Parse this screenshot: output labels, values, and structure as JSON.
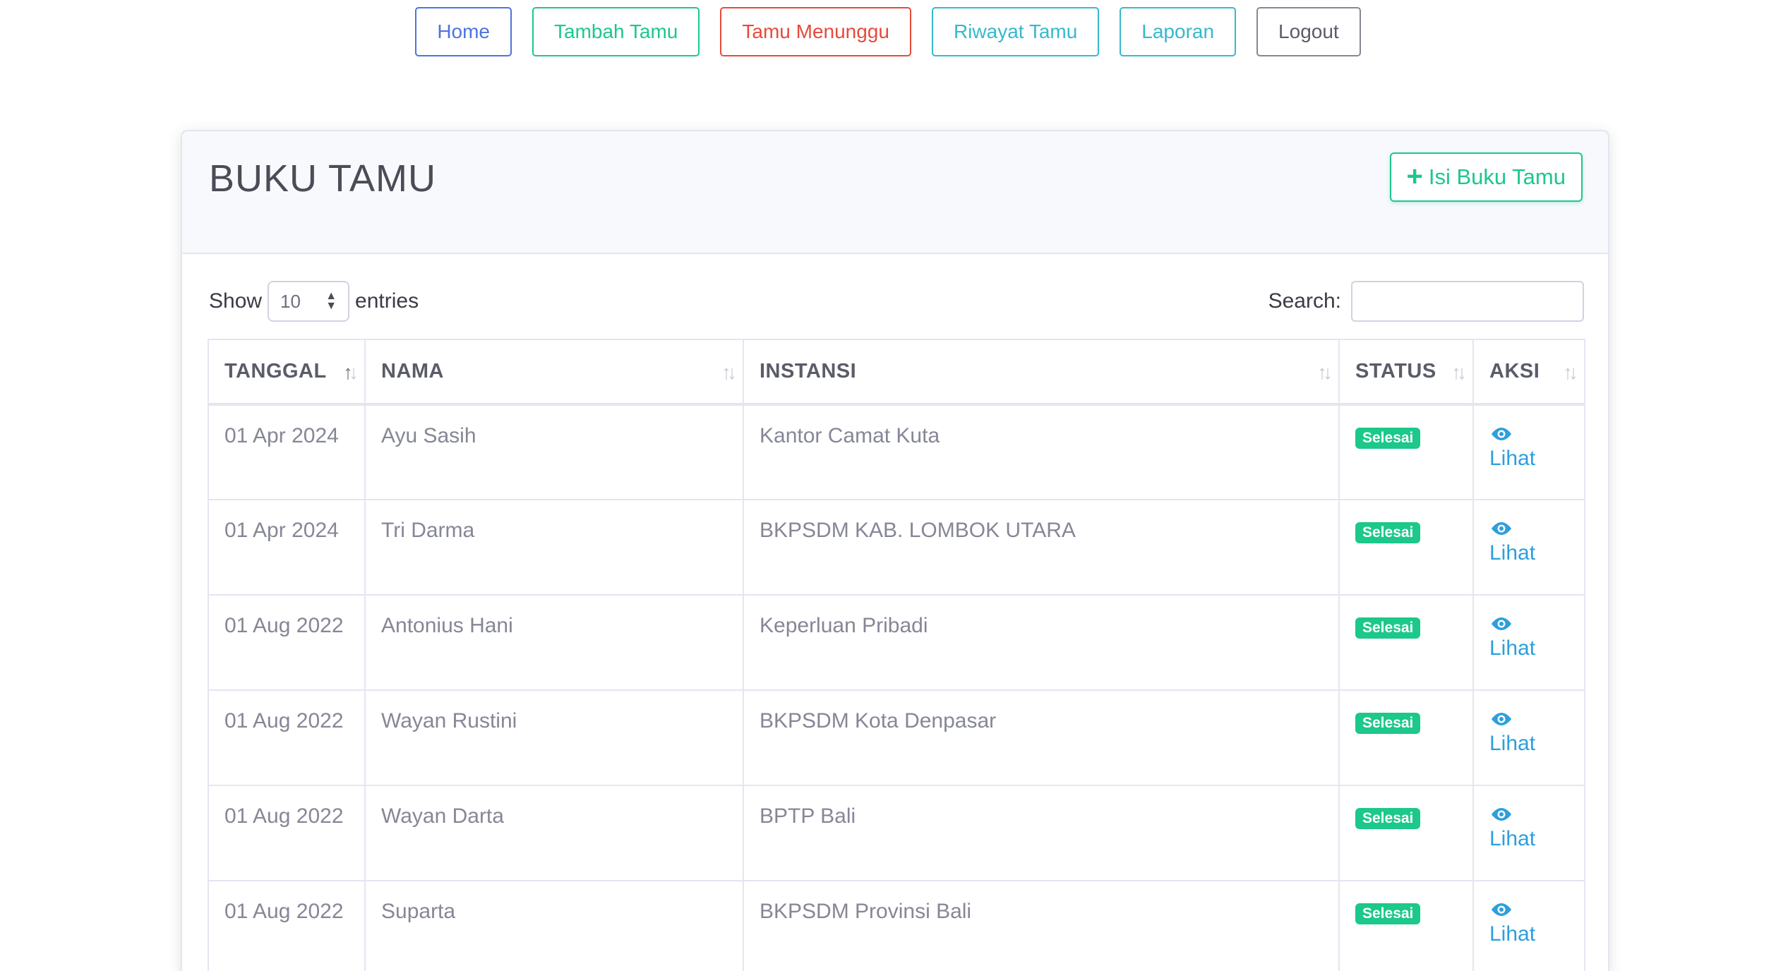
{
  "nav": [
    {
      "label": "Home",
      "color": "#4e73df"
    },
    {
      "label": "Tambah Tamu",
      "color": "#1cc88a"
    },
    {
      "label": "Tamu Menunggu",
      "color": "#e74a3b"
    },
    {
      "label": "Riwayat Tamu",
      "color": "#36b9cc"
    },
    {
      "label": "Laporan",
      "color": "#36b9cc"
    },
    {
      "label": "Logout",
      "color": "#5a5c69"
    }
  ],
  "header": {
    "title": "BUKU TAMU",
    "add_button_label": "Isi Buku Tamu"
  },
  "length": {
    "show_label": "Show",
    "selected": "10",
    "entries_label": "entries"
  },
  "search": {
    "label": "Search:",
    "value": ""
  },
  "table": {
    "columns": [
      "TANGGAL",
      "NAMA",
      "INSTANSI",
      "STATUS",
      "AKSI"
    ],
    "rows": [
      {
        "tanggal": "01 Apr 2024",
        "nama": "Ayu Sasih",
        "instansi": "Kantor Camat Kuta",
        "status": "Selesai",
        "aksi": "Lihat"
      },
      {
        "tanggal": "01 Apr 2024",
        "nama": "Tri Darma",
        "instansi": "BKPSDM KAB. LOMBOK UTARA",
        "status": "Selesai",
        "aksi": "Lihat"
      },
      {
        "tanggal": "01 Aug 2022",
        "nama": "Antonius Hani",
        "instansi": "Keperluan Pribadi",
        "status": "Selesai",
        "aksi": "Lihat"
      },
      {
        "tanggal": "01 Aug 2022",
        "nama": "Wayan Rustini",
        "instansi": "BKPSDM Kota Denpasar",
        "status": "Selesai",
        "aksi": "Lihat"
      },
      {
        "tanggal": "01 Aug 2022",
        "nama": "Wayan Darta",
        "instansi": "BPTP Bali",
        "status": "Selesai",
        "aksi": "Lihat"
      },
      {
        "tanggal": "01 Aug 2022",
        "nama": "Suparta",
        "instansi": "BKPSDM Provinsi Bali",
        "status": "Selesai",
        "aksi": "Lihat"
      }
    ]
  },
  "colors": {
    "success": "#1cc88a",
    "link": "#2c9fdc"
  }
}
